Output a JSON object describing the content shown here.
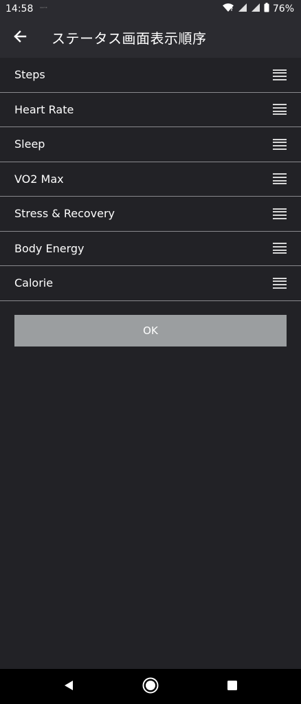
{
  "status_bar": {
    "time": "14:58",
    "small_text": "ᴺᴼᵀᴱ",
    "battery": "76%",
    "icons": [
      "wifi-icon",
      "signal-icon",
      "signal-icon",
      "battery-icon"
    ]
  },
  "header": {
    "title": "ステータス画面表示順序",
    "back_icon": "arrow-left-icon"
  },
  "list": {
    "items": [
      {
        "label": "Steps"
      },
      {
        "label": "Heart Rate"
      },
      {
        "label": "Sleep"
      },
      {
        "label": "VO2 Max"
      },
      {
        "label": "Stress & Recovery"
      },
      {
        "label": "Body Energy"
      },
      {
        "label": "Calorie"
      }
    ],
    "handle_icon": "drag-handle-icon"
  },
  "ok_button": {
    "label": "OK"
  },
  "nav_bar": {
    "icons": [
      "back-triangle-icon",
      "home-circle-icon",
      "recents-square-icon"
    ]
  },
  "colors": {
    "background": "#222226",
    "app_bar": "#2b2b30",
    "divider": "#8a8a8e",
    "button": "#9b9ea0"
  }
}
